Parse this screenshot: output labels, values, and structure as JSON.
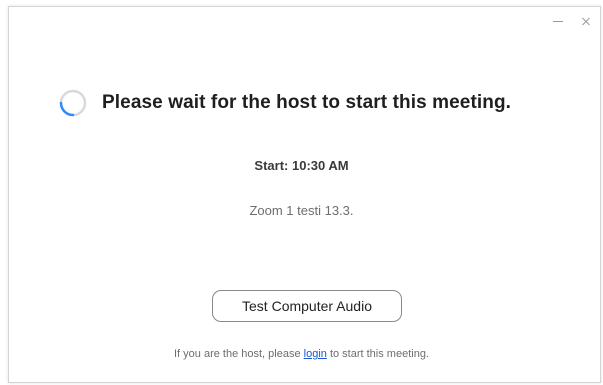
{
  "window": {
    "minimize_icon": "minimize-icon",
    "close_icon": "close-icon"
  },
  "status": {
    "spinner_icon": "loading-spinner-icon",
    "message": "Please wait for the host to start this meeting."
  },
  "meeting": {
    "start_label": "Start: 10:30 AM",
    "name": "Zoom 1 testi 13.3."
  },
  "actions": {
    "test_audio_label": "Test Computer Audio"
  },
  "host_note": {
    "prefix": "If you are the host, please ",
    "link_label": "login",
    "suffix": " to start this meeting."
  },
  "colors": {
    "link": "#1a57d6",
    "spinner_track": "#d9d9d9",
    "spinner_arc": "#2d8cff"
  }
}
